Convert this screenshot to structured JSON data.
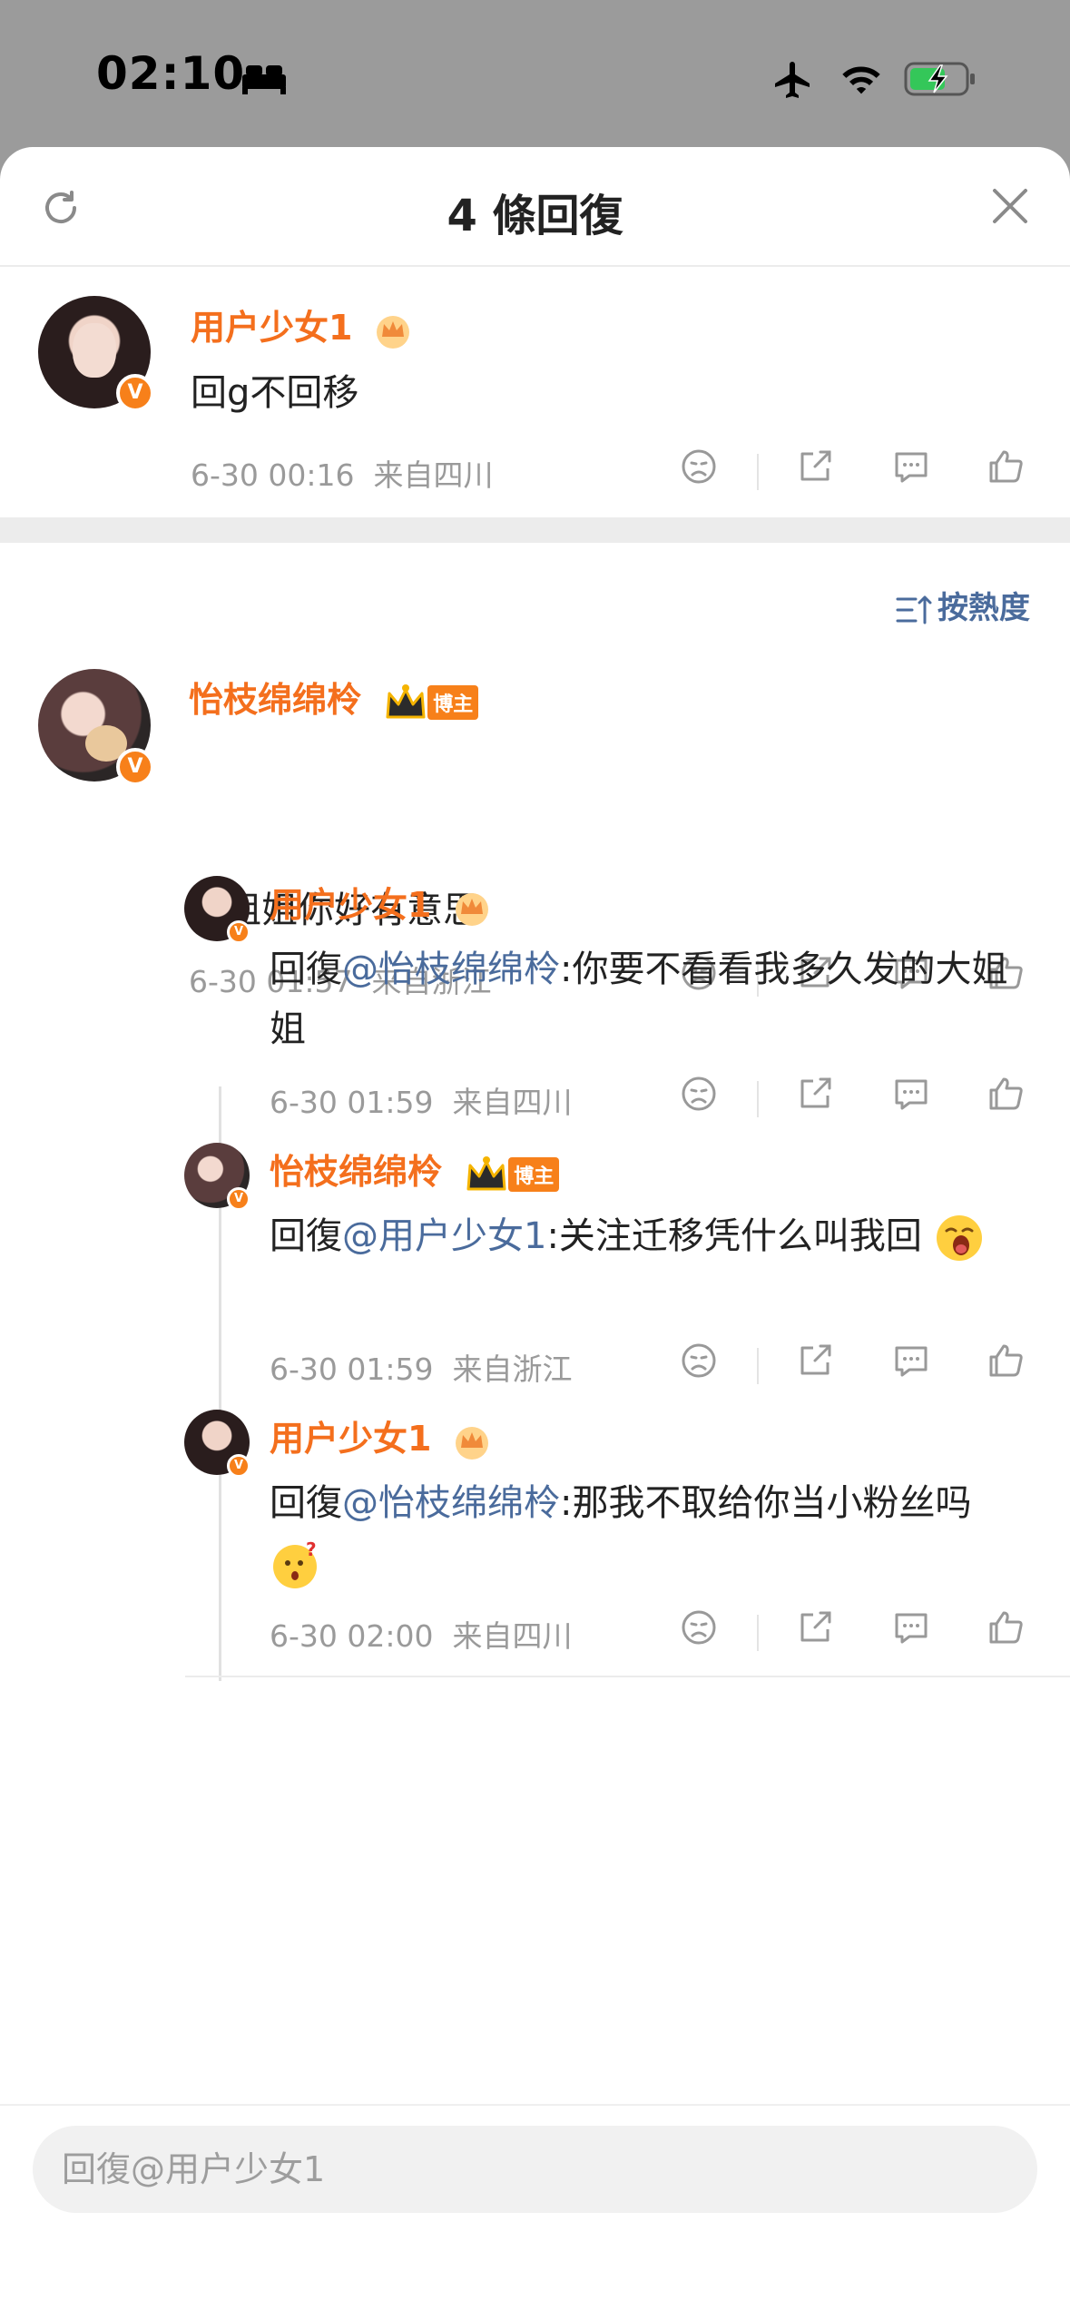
{
  "status_bar": {
    "time": "02:10"
  },
  "header": {
    "title": "4 條回復"
  },
  "main_comment": {
    "user": "用户少女1",
    "text": "回g不回移",
    "date": "6-30 00:16",
    "location": "来自四川"
  },
  "sort": {
    "label": "按熱度"
  },
  "replies": [
    {
      "user": "怡枝绵绵柃",
      "tag": "博主",
      "prefix": "",
      "mention": "",
      "text": "大姐姐你好有意思",
      "date": "6-30 01:57",
      "location": "来自浙江"
    },
    {
      "user": "用户少女1",
      "tag": "",
      "prefix": "回復",
      "mention": "@怡枝绵绵柃",
      "text": ":你要不看看我多久发的大姐姐",
      "date": "6-30 01:59",
      "location": "来自四川"
    },
    {
      "user": "怡枝绵绵柃",
      "tag": "博主",
      "prefix": "回復",
      "mention": "@用户少女1",
      "text": ":关注迁移凭什么叫我回",
      "date": "6-30 01:59",
      "location": "来自浙江"
    },
    {
      "user": "用户少女1",
      "tag": "",
      "prefix": "回復",
      "mention": "@怡枝绵绵柃",
      "text": ":那我不取给你当小粉丝吗",
      "date": "6-30 02:00",
      "location": "来自四川"
    }
  ],
  "composer": {
    "placeholder": "回復@用户少女1"
  },
  "colors": {
    "username": "#f46f1d",
    "mention": "#4a6b9c",
    "meta": "#9a9a9a",
    "badge": "#f7801a"
  }
}
